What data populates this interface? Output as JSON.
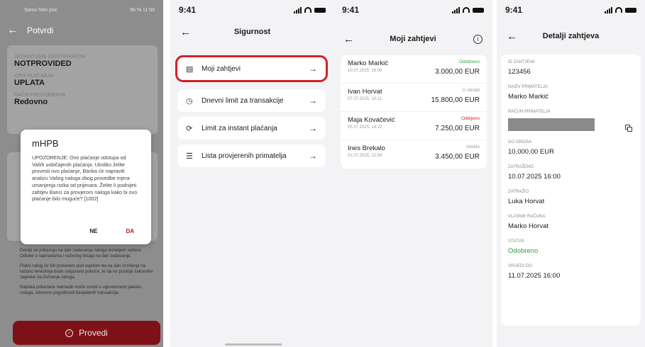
{
  "colors": {
    "brand_red": "#7e1118",
    "approved_green": "#2e9e3e",
    "rejected_red": "#d4202a",
    "highlight_red": "#d4202a",
    "muted_gray": "#9a9a9a"
  },
  "screen1": {
    "status_left": "Samo hitni poz.",
    "status_right": "96 %  11:50",
    "title": "Potvrdi",
    "fields": [
      {
        "label": "JEDINSTVENI IDENTIFIKATOR",
        "value": "NOTPROVIDED"
      },
      {
        "label": "OPIS PLAĆANJA",
        "value": "UPLATA"
      },
      {
        "label": "NAČIN PROVOĐENJA",
        "value": "Redovno"
      }
    ],
    "dialog": {
      "title": "mHPB",
      "body": "UPOZORENJE: Ovo plaćanje odstupa od Vaših uobičajenih plaćanja. Ukoliko želite provesti ovo plaćanje, Banka će napraviti analizu Vašeg naloga zbog provedbe mjera umanjenja rizika od prijevara. Želite li podnijeti zahtjev Banci za provjerom naloga kako bi ovo plaćanje bilo moguće? [1002]",
      "no": "NE",
      "yes": "DA"
    },
    "notes": [
      "Detalji se prikazuju na dan zadavanja naloga temeljem važeće Odluke o naknadama i važećeg tečaja na dan zadavanja.",
      "Platni nalog će biti proveden pod uvjetom da na dan izvršenja na računu terećenja bude osigurano pokriće, te da ne postoje zakonske zapreke za izvršenje naloga.",
      "Naplata prikazane naknade može ovisiti o ugovorenom paketu usluga, odnosno pogodnosti besplatnih transakcija."
    ],
    "button": "Provedi"
  },
  "screen2": {
    "time": "9:41",
    "title": "Sigurnost",
    "items": [
      {
        "label": "Moji zahtjevi",
        "icon": "document-icon",
        "glyph": "▤"
      },
      {
        "label": "Dnevni limit za transakcije",
        "icon": "clock-icon",
        "glyph": "◷"
      },
      {
        "label": "Limit za instant plaćanja",
        "icon": "instant-icon",
        "glyph": "⟳"
      },
      {
        "label": "Lista provjerenih primatelja",
        "icon": "list-icon",
        "glyph": "☰"
      }
    ]
  },
  "screen3": {
    "time": "9:41",
    "title": "Moji zahtjevi",
    "requests": [
      {
        "name": "Marko Markić",
        "date": "10.07.2025. 16:00",
        "status": "Odobreno",
        "status_color": "#2e9e3e",
        "amount": "3.000,00 EUR"
      },
      {
        "name": "Ivan Horvat",
        "date": "07.07.2025. 10:11",
        "status": "U obradi",
        "status_color": "#9a9a9a",
        "amount": "15.800,00 EUR"
      },
      {
        "name": "Maja Kovačević",
        "date": "05.07.2025. 14:22",
        "status": "Odbijeno",
        "status_color": "#d4202a",
        "amount": "7.250,00 EUR"
      },
      {
        "name": "Ines Brekalo",
        "date": "01.07.2025. 12:54",
        "status": "Isteklo",
        "status_color": "#9a9a9a",
        "amount": "3.450,00 EUR"
      }
    ]
  },
  "screen4": {
    "time": "9:41",
    "title": "Detalji zahtjeva",
    "fields": [
      {
        "label": "ID ZAHTJEVA",
        "value": "123456"
      },
      {
        "label": "NAZIV PRIMATELJA",
        "value": "Marko Markić"
      },
      {
        "label": "RAČUN PRIMATELJA",
        "value": ""
      },
      {
        "label": "DO IZNOSA",
        "value": "10.000,00 EUR"
      },
      {
        "label": "ZATRAŽENO",
        "value": "10.07.2025 16:00"
      },
      {
        "label": "ZATRAŽIO",
        "value": "Luka Horvat"
      },
      {
        "label": "VLASNIK RAČUNA",
        "value": "Marko Horvat"
      },
      {
        "label": "STATUS",
        "value": "Odobreno"
      },
      {
        "label": "VRIJEDI DO",
        "value": "11.07.2025 16:00"
      }
    ]
  }
}
